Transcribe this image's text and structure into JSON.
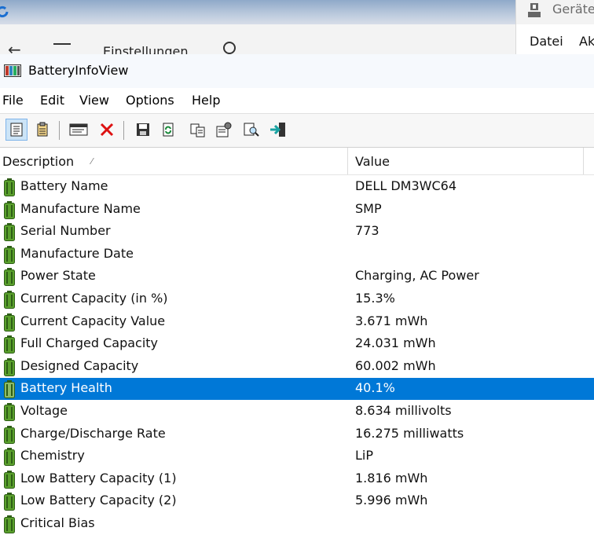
{
  "background": {
    "settings_window": {
      "title": "Einstellungen"
    },
    "devices_window": {
      "title": "Geräte",
      "menu": [
        "Datei",
        "Ak"
      ]
    }
  },
  "app": {
    "title": "BatteryInfoView",
    "menu": [
      "File",
      "Edit",
      "View",
      "Options",
      "Help"
    ],
    "toolbar": [
      {
        "icon": "html-report-icon",
        "pressed": true
      },
      {
        "icon": "text-report-icon",
        "pressed": false
      },
      {
        "icon": "properties-window-icon",
        "pressed": false
      },
      {
        "icon": "delete-icon",
        "pressed": false
      },
      {
        "icon": "save-icon",
        "pressed": false
      },
      {
        "icon": "refresh-icon",
        "pressed": false
      },
      {
        "icon": "copy-icon",
        "pressed": false
      },
      {
        "icon": "properties-icon",
        "pressed": false
      },
      {
        "icon": "find-icon",
        "pressed": false
      },
      {
        "icon": "exit-icon",
        "pressed": false
      }
    ],
    "columns": {
      "description": "Description",
      "value": "Value"
    },
    "rows": [
      {
        "description": "Battery Name",
        "value": "DELL DM3WC64"
      },
      {
        "description": "Manufacture Name",
        "value": "SMP"
      },
      {
        "description": "Serial Number",
        "value": "773"
      },
      {
        "description": "Manufacture Date",
        "value": ""
      },
      {
        "description": "Power State",
        "value": "Charging, AC Power"
      },
      {
        "description": "Current Capacity (in %)",
        "value": "15.3%"
      },
      {
        "description": "Current Capacity Value",
        "value": "3.671 mWh"
      },
      {
        "description": "Full Charged Capacity",
        "value": "24.031 mWh"
      },
      {
        "description": "Designed Capacity",
        "value": "60.002 mWh"
      },
      {
        "description": "Battery Health",
        "value": "40.1%",
        "selected": true
      },
      {
        "description": "Voltage",
        "value": "8.634 millivolts"
      },
      {
        "description": "Charge/Discharge Rate",
        "value": "16.275 milliwatts"
      },
      {
        "description": "Chemistry",
        "value": "LiP"
      },
      {
        "description": "Low Battery Capacity (1)",
        "value": "1.816 mWh"
      },
      {
        "description": "Low Battery Capacity (2)",
        "value": "5.996 mWh"
      },
      {
        "description": "Critical Bias",
        "value": ""
      }
    ],
    "colors": {
      "selection": "#0078d7",
      "battery_green": "#5aa02c"
    }
  }
}
